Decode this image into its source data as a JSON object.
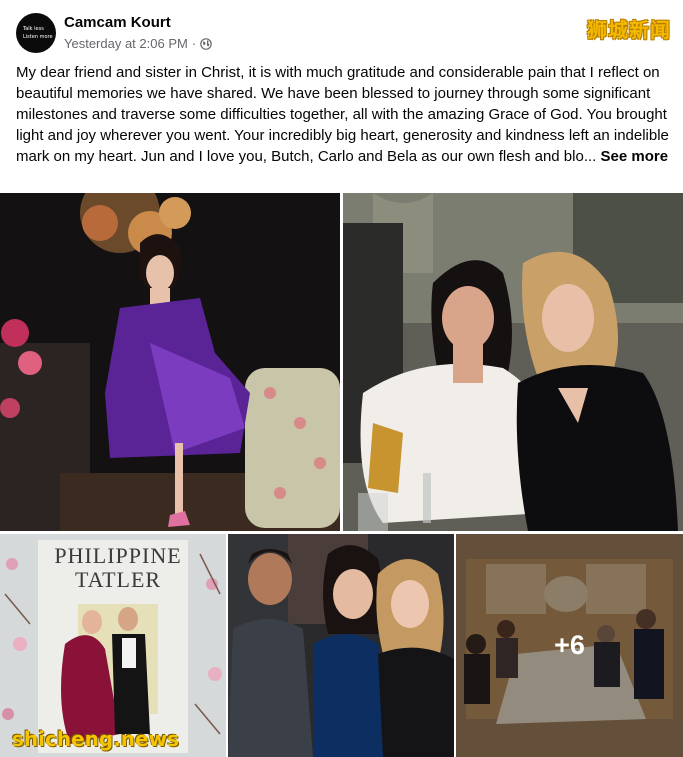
{
  "post": {
    "author": "Camcam Kourt",
    "avatar_text": [
      "Talk less",
      "Listen more"
    ],
    "timestamp": "Yesterday at 2:06 PM",
    "separator": "·",
    "privacy_icon": "globe-icon",
    "caption": "My dear friend and sister in Christ, it is with much gratitude and considerable pain that I reflect on beautiful memories we have shared. We have been blessed to journey through some significant milestones and traverse some difficulties together, all with the amazing Grace of God. You brought light and joy wherever you went. Your incredibly big heart, generosity and kindness left an indelible mark on my heart. Jun and I love you, Butch, Carlo and Bela as our own flesh and blo...",
    "see_more": "See more"
  },
  "photos": {
    "more_count": "+6",
    "magazine_title": [
      "PHILIPPINE",
      "TATLER"
    ]
  },
  "watermarks": {
    "top": "狮城新闻",
    "bottom": "shicheng.news"
  },
  "colors": {
    "secondary_text": "#65676b",
    "watermark": "#f5b800"
  }
}
